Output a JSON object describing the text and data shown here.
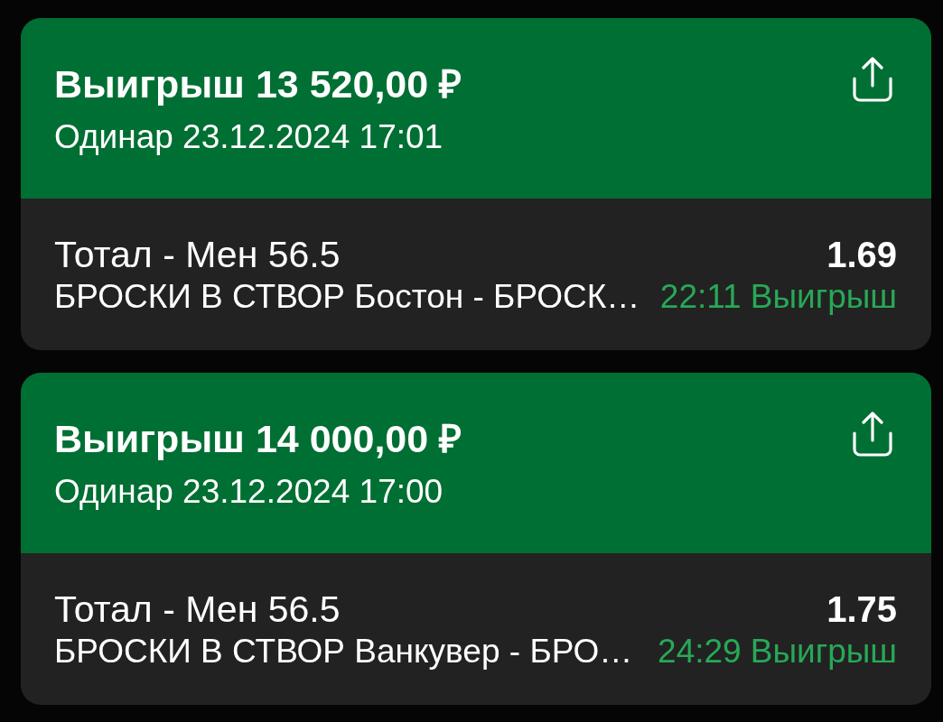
{
  "bets": [
    {
      "title": "Выигрыш 13 520,00 ₽",
      "subtitle": "Одинар 23.12.2024 17:01",
      "market": "Тотал - Мен 56.5",
      "odds": "1.69",
      "event": "БРОСКИ В СТВОР Бостон - БРОСК…",
      "time": "22:11",
      "status": "Выигрыш"
    },
    {
      "title": "Выигрыш 14 000,00 ₽",
      "subtitle": "Одинар 23.12.2024 17:00",
      "market": "Тотал - Мен 56.5",
      "odds": "1.75",
      "event": "БРОСКИ В СТВОР Ванкувер - БРО…",
      "time": "24:29",
      "status": "Выигрыш"
    }
  ]
}
